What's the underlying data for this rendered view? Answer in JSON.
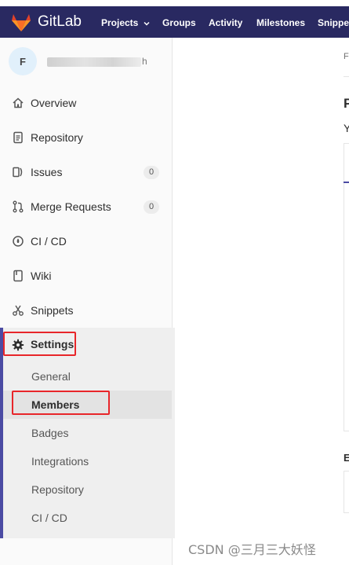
{
  "navbar": {
    "brand": "GitLab",
    "items": [
      "Projects",
      "Groups",
      "Activity",
      "Milestones",
      "Snippets"
    ],
    "colors": {
      "background": "#292961"
    }
  },
  "sidebar": {
    "avatar_letter": "F",
    "project_name_tail": "h",
    "items": [
      {
        "label": "Overview",
        "icon": "home-icon"
      },
      {
        "label": "Repository",
        "icon": "document-icon"
      },
      {
        "label": "Issues",
        "icon": "issues-icon",
        "count": "0"
      },
      {
        "label": "Merge Requests",
        "icon": "merge-request-icon",
        "count": "0"
      },
      {
        "label": "CI / CD",
        "icon": "rocket-icon"
      },
      {
        "label": "Wiki",
        "icon": "book-icon"
      },
      {
        "label": "Snippets",
        "icon": "scissors-icon"
      }
    ],
    "settings": {
      "label": "Settings",
      "icon": "gear-icon",
      "subitems": [
        "General",
        "Members",
        "Badges",
        "Integrations",
        "Repository",
        "CI / CD"
      ],
      "active": "Members"
    },
    "accent_color": "#4b4ba3",
    "highlight_color": "#e8262a"
  },
  "main": {
    "breadcrumb": "Fi",
    "title": "P",
    "subtitle": "Y",
    "section": "E"
  },
  "watermark": "CSDN @三月三大妖怪"
}
